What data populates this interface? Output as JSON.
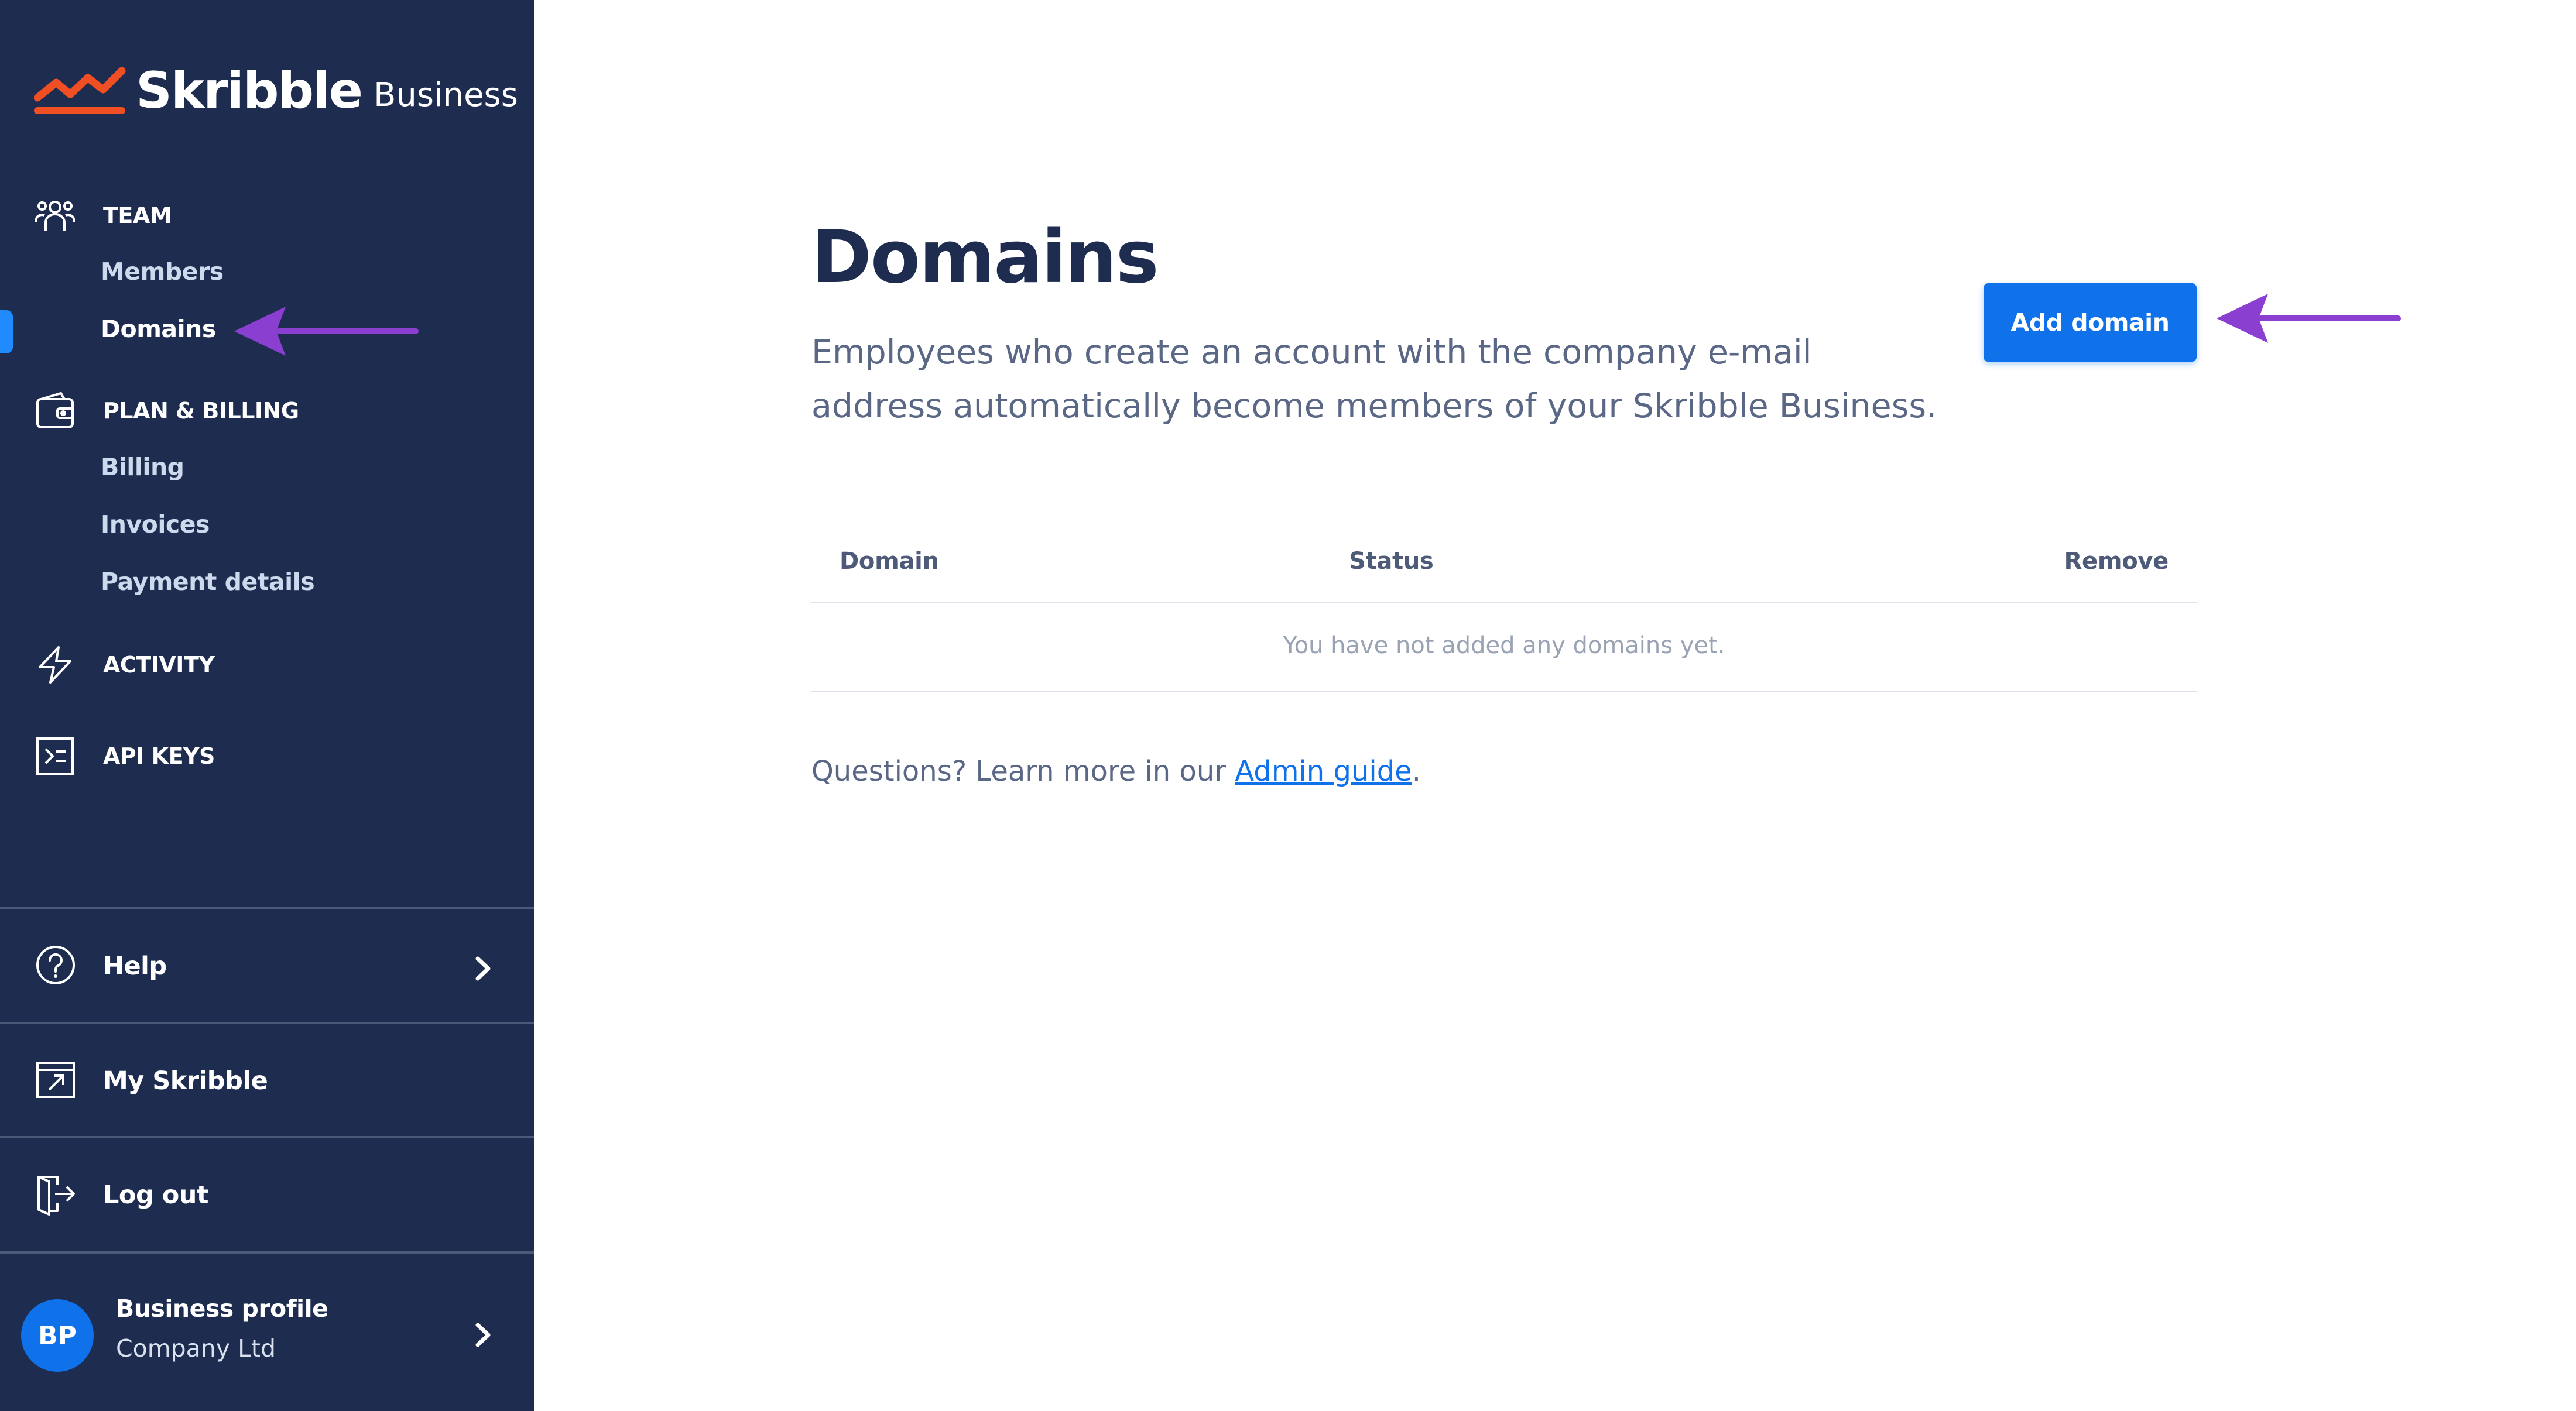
{
  "brand": {
    "name": "Skribble",
    "suffix": "Business",
    "logo_icon": "skribble-zigzag-logo",
    "accent_color": "#f04e23"
  },
  "sidebar": {
    "background": "#1e2d4f",
    "sections": [
      {
        "label": "TEAM",
        "icon": "team-icon",
        "items": [
          "Members",
          "Domains"
        ]
      },
      {
        "label": "PLAN & BILLING",
        "icon": "wallet-icon",
        "items": [
          "Billing",
          "Invoices",
          "Payment details"
        ]
      },
      {
        "label": "ACTIVITY",
        "icon": "lightning-icon",
        "items": []
      },
      {
        "label": "API KEYS",
        "icon": "terminal-icon",
        "items": []
      }
    ],
    "active_item": "Domains",
    "bottom": {
      "help": {
        "label": "Help",
        "icon": "help-icon"
      },
      "my_skribble": {
        "label": "My Skribble",
        "icon": "external-window-icon"
      },
      "logout": {
        "label": "Log out",
        "icon": "logout-icon"
      }
    },
    "profile": {
      "initials": "BP",
      "name": "Business profile",
      "company": "Company Ltd"
    }
  },
  "main": {
    "title": "Domains",
    "description": "Employees who create an account with the company e-mail address automatically become members of your Skribble Business.",
    "add_button": "Add domain",
    "table": {
      "columns": [
        "Domain",
        "Status",
        "Remove"
      ],
      "empty_message": "You have not added any domains yet."
    },
    "footer": {
      "prefix": "Questions? Learn more in our ",
      "link": "Admin guide",
      "suffix": "."
    }
  },
  "annotations": {
    "arrow_color": "#8a3fd1"
  },
  "colors": {
    "primary_button": "#0f72ea",
    "active_indicator": "#1f8bff"
  }
}
